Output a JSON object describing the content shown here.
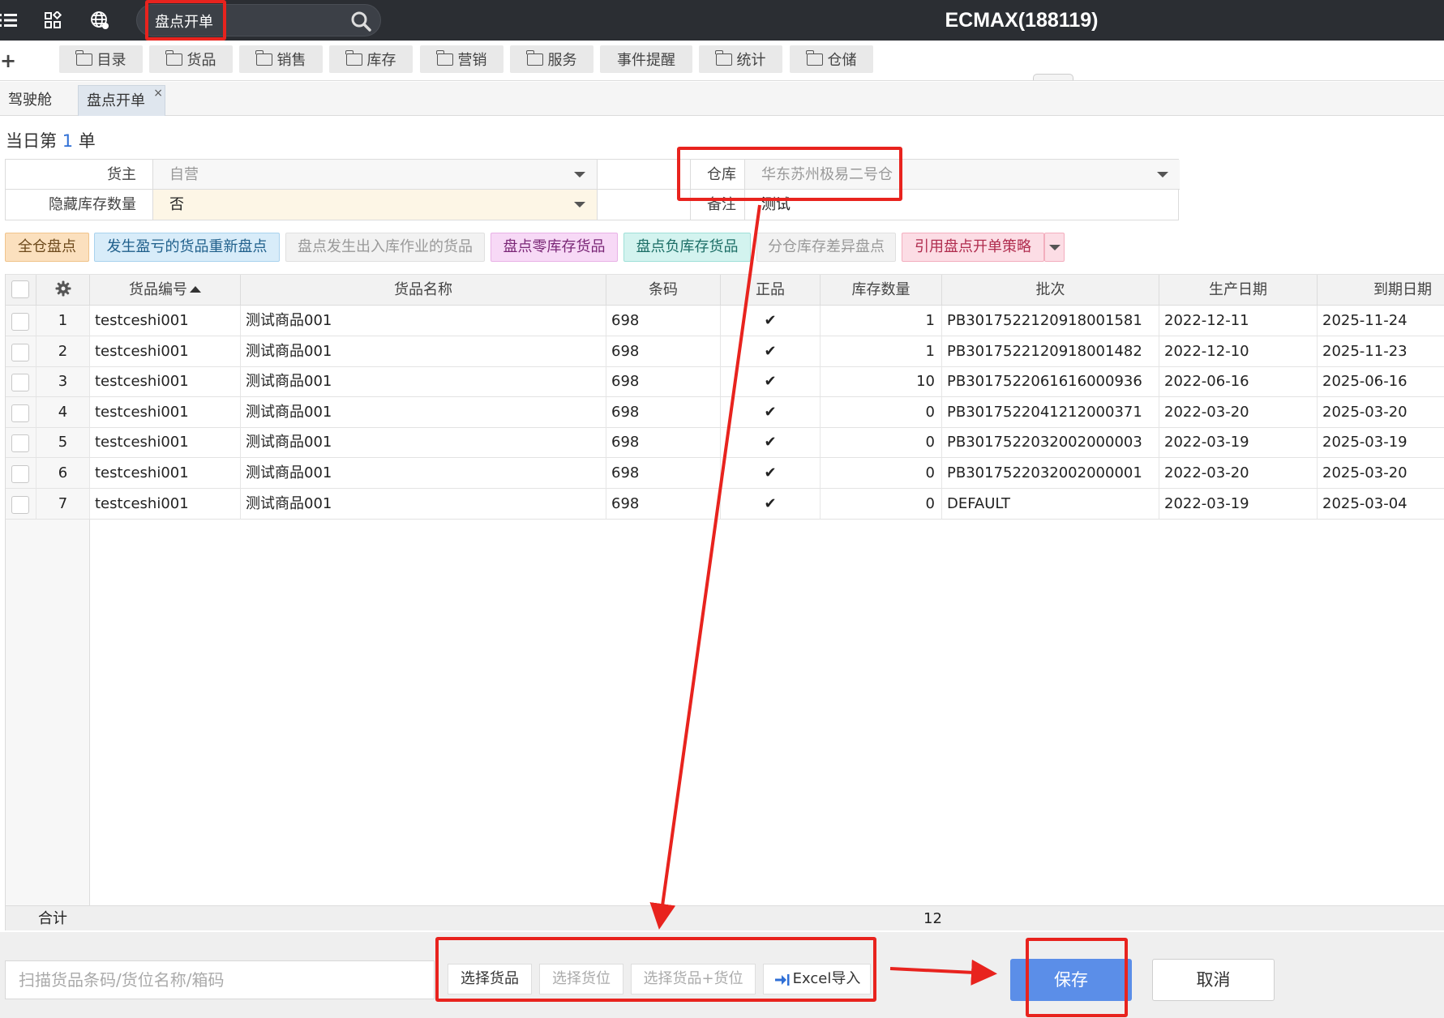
{
  "header": {
    "brand": "ECMAX(188119)",
    "search_value": "盘点开单",
    "icons": [
      "menu-icon",
      "grid-icon",
      "globe-icon",
      "search-icon"
    ]
  },
  "nav": {
    "items": [
      "目录",
      "货品",
      "销售",
      "库存",
      "营销",
      "服务",
      "事件提醒",
      "统计",
      "仓储"
    ]
  },
  "tabs": [
    {
      "label": "驾驶舱"
    },
    {
      "label": "盘点开单",
      "close": "×"
    }
  ],
  "doc": {
    "prefix": "当日第 ",
    "number": "1",
    "suffix": " 单"
  },
  "form": {
    "owner_label": "货主",
    "owner_value": "自营",
    "hide_label": "隐藏库存数量",
    "hide_value": "否",
    "warehouse_label": "仓库",
    "warehouse_value": "华东苏州极易二号仓",
    "remark_label": "备注",
    "remark_value": "测试"
  },
  "actions": [
    "全仓盘点",
    "发生盈亏的货品重新盘点",
    "盘点发生出入库作业的货品",
    "盘点零库存货品",
    "盘点负库存货品",
    "分仓库存差异盘点",
    "引用盘点开单策略"
  ],
  "grid": {
    "columns": [
      "货品编号",
      "货品名称",
      "条码",
      "正品",
      "库存数量",
      "批次",
      "生产日期",
      "到期日期"
    ],
    "rows": [
      {
        "idx": "1",
        "code": "testceshi001",
        "name": "测试商品001",
        "barcode": "698",
        "genuine": "✔",
        "qty": "1",
        "batch": "PB3017522120918001581",
        "mfg": "2022-12-11",
        "exp": "2025-11-24"
      },
      {
        "idx": "2",
        "code": "testceshi001",
        "name": "测试商品001",
        "barcode": "698",
        "genuine": "✔",
        "qty": "1",
        "batch": "PB3017522120918001482",
        "mfg": "2022-12-10",
        "exp": "2025-11-23"
      },
      {
        "idx": "3",
        "code": "testceshi001",
        "name": "测试商品001",
        "barcode": "698",
        "genuine": "✔",
        "qty": "10",
        "batch": "PB3017522061616000936",
        "mfg": "2022-06-16",
        "exp": "2025-06-16"
      },
      {
        "idx": "4",
        "code": "testceshi001",
        "name": "测试商品001",
        "barcode": "698",
        "genuine": "✔",
        "qty": "0",
        "batch": "PB3017522041212000371",
        "mfg": "2022-03-20",
        "exp": "2025-03-20"
      },
      {
        "idx": "5",
        "code": "testceshi001",
        "name": "测试商品001",
        "barcode": "698",
        "genuine": "✔",
        "qty": "0",
        "batch": "PB3017522032002000003",
        "mfg": "2022-03-19",
        "exp": "2025-03-19"
      },
      {
        "idx": "6",
        "code": "testceshi001",
        "name": "测试商品001",
        "barcode": "698",
        "genuine": "✔",
        "qty": "0",
        "batch": "PB3017522032002000001",
        "mfg": "2022-03-20",
        "exp": "2025-03-20"
      },
      {
        "idx": "7",
        "code": "testceshi001",
        "name": "测试商品001",
        "barcode": "698",
        "genuine": "✔",
        "qty": "0",
        "batch": "DEFAULT",
        "mfg": "2022-03-19",
        "exp": "2025-03-04"
      }
    ],
    "total_label": "合计",
    "total_qty": "12"
  },
  "bottom": {
    "scan_placeholder": "扫描货品条码/货位名称/箱码",
    "select_goods": "选择货品",
    "select_location": "选择货位",
    "select_goods_location": "选择货品+货位",
    "excel_import": "Excel导入",
    "save": "保存",
    "cancel": "取消"
  },
  "colors": {
    "annotation": "#e8231e",
    "save": "#5b8ee8",
    "topbar": "#2b2e33"
  }
}
